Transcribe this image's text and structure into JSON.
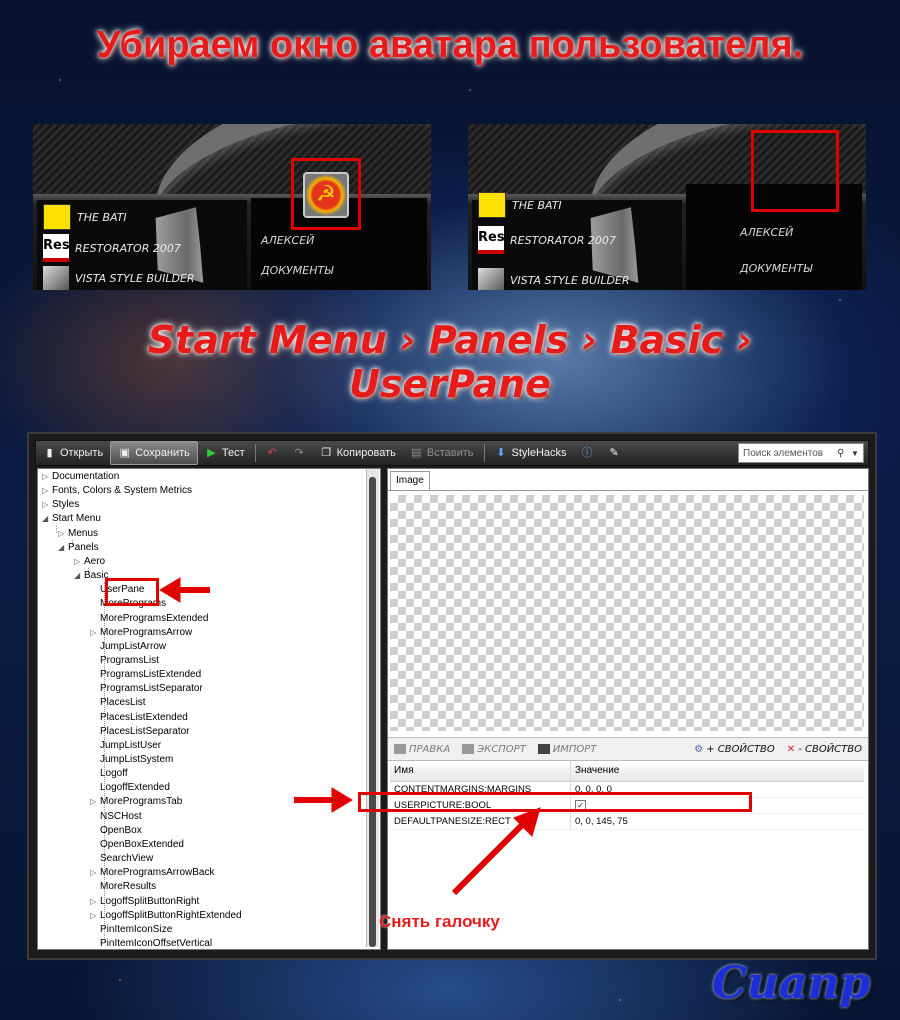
{
  "heading": "Убираем окно аватара пользователя.",
  "before_shot": {
    "items": [
      "THE BATI",
      "RESTORATOR 2007",
      "VISTA STYLE BUILDER"
    ],
    "right_items": [
      "АЛЕКСЕЙ",
      "ДОКУМЕНТЫ"
    ],
    "icon_res": "Res"
  },
  "after_shot": {
    "items": [
      "THE BATI",
      "RESTORATOR 2007",
      "VISTA STYLE BUILDER"
    ],
    "right_items": [
      "АЛЕКСЕЙ",
      "ДОКУМЕНТЫ"
    ],
    "icon_res": "Res"
  },
  "path_line1": "Start Menu › Panels › Basic ›",
  "path_line2": "UserPane",
  "toolbar": {
    "open": "Открыть",
    "save": "Сохранить",
    "test": "Тест",
    "copy": "Копировать",
    "paste": "Вставить",
    "stylehacks": "StyleHacks",
    "search_placeholder": "Поиск элементов"
  },
  "tree": {
    "top": [
      "Documentation",
      "Fonts, Colors & System Metrics",
      "Styles",
      "Start Menu"
    ],
    "start_menu_children": [
      "Menus",
      "Panels"
    ],
    "panels_children": [
      "Aero",
      "Basic"
    ],
    "basic_children": [
      "UserPane",
      "MorePrograms",
      "MoreProgramsExtended",
      "MoreProgramsArrow",
      "JumpListArrow",
      "ProgramsList",
      "ProgramsListExtended",
      "ProgramsListSeparator",
      "PlacesList",
      "PlacesListExtended",
      "PlacesListSeparator",
      "JumpListUser",
      "JumpListSystem",
      "Logoff",
      "LogoffExtended",
      "MoreProgramsTab",
      "NSCHost",
      "OpenBox",
      "OpenBoxExtended",
      "SearchView",
      "MoreProgramsArrowBack",
      "MoreResults",
      "LogoffSplitButtonRight",
      "LogoffSplitButtonRightExtended",
      "PinItemIconSize",
      "PinItemIconOffsetVertical"
    ]
  },
  "image_tab": "Image",
  "props_toolbar": {
    "edit": "ПРАВКА",
    "export": "ЭКСПОРТ",
    "import": "ИМПОРТ",
    "add_prop": "+ СВОЙСТВО",
    "remove_prop": "- СВОЙСТВО"
  },
  "props": {
    "col_name": "Имя",
    "col_value": "Значение",
    "rows": [
      {
        "name": "CONTENTMARGINS:MARGINS",
        "value": "0, 0, 0, 0"
      },
      {
        "name": "USERPICTURE:BOOL",
        "value": "✓"
      },
      {
        "name": "DEFAULTPANESIZE:RECT",
        "value": "0, 0, 145, 75"
      }
    ]
  },
  "caption": "Снять галочку",
  "signature": "Сиапр",
  "colors": {
    "annotation": "#e10000",
    "title": "#e81b1b",
    "signature": "#1c2fd6"
  }
}
